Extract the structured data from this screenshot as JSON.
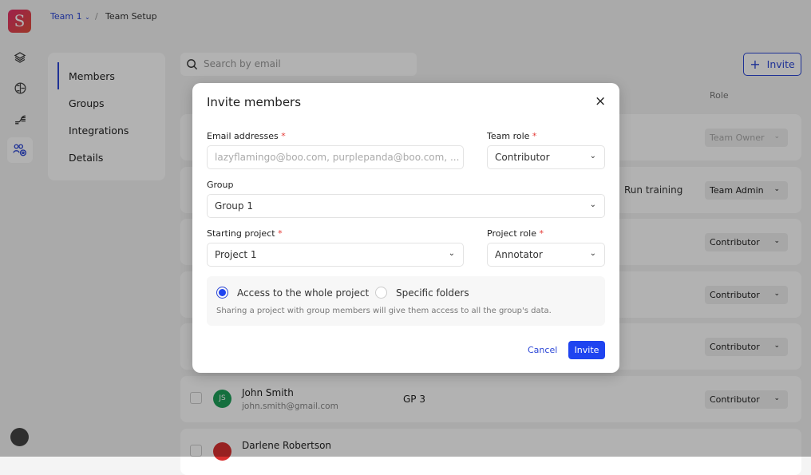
{
  "breadcrumb": {
    "team": "Team 1",
    "page": "Team Setup"
  },
  "logo": "S",
  "sidebar_icons": [
    "layers-icon",
    "brain-icon",
    "pipeline-icon",
    "team-settings-icon"
  ],
  "nav": {
    "items": [
      "Members",
      "Groups",
      "Integrations",
      "Details"
    ],
    "active": "Members"
  },
  "search": {
    "placeholder": "Search by email"
  },
  "invite_button": "Invite",
  "table": {
    "role_header": "Role",
    "rows": [
      {
        "name": "",
        "email": "",
        "group": "",
        "permission": "",
        "role": "Team Owner",
        "disabled": true
      },
      {
        "name": "",
        "email": "",
        "group": "",
        "permission": "Run training",
        "role": "Team Admin"
      },
      {
        "name": "",
        "email": "",
        "group": "",
        "permission": "",
        "role": "Contributor"
      },
      {
        "name": "",
        "email": "",
        "group": "",
        "permission": "",
        "role": "Contributor"
      },
      {
        "name": "",
        "email": "",
        "group": "",
        "permission": "",
        "role": "Contributor"
      },
      {
        "name": "John Smith",
        "email": "john.smith@gmail.com",
        "initials": "JS",
        "avatar_color": "#1ea05a",
        "group": "GP 3",
        "permission": "",
        "role": "Contributor"
      },
      {
        "name": "Darlene Robertson",
        "email": "",
        "avatar_color": "#d93030",
        "group": "",
        "permission": "",
        "role": ""
      }
    ]
  },
  "modal": {
    "title": "Invite members",
    "email_label": "Email addresses",
    "email_placeholder": "lazyflamingo@boo.com, purplepanda@boo.com, ...",
    "team_role_label": "Team role",
    "team_role_value": "Contributor",
    "group_label": "Group",
    "group_value": "Group 1",
    "project_label": "Starting project",
    "project_value": "Project 1",
    "project_role_label": "Project role",
    "project_role_value": "Annotator",
    "access_whole": "Access to the whole project",
    "access_folders": "Specific folders",
    "access_selected": "whole",
    "note": "Sharing a project with group members will give them access to all the group's data.",
    "cancel": "Cancel",
    "invite": "Invite",
    "required_mark": "*"
  },
  "colors": {
    "accent": "#2c47d6",
    "primary_button": "#1f44f0"
  }
}
